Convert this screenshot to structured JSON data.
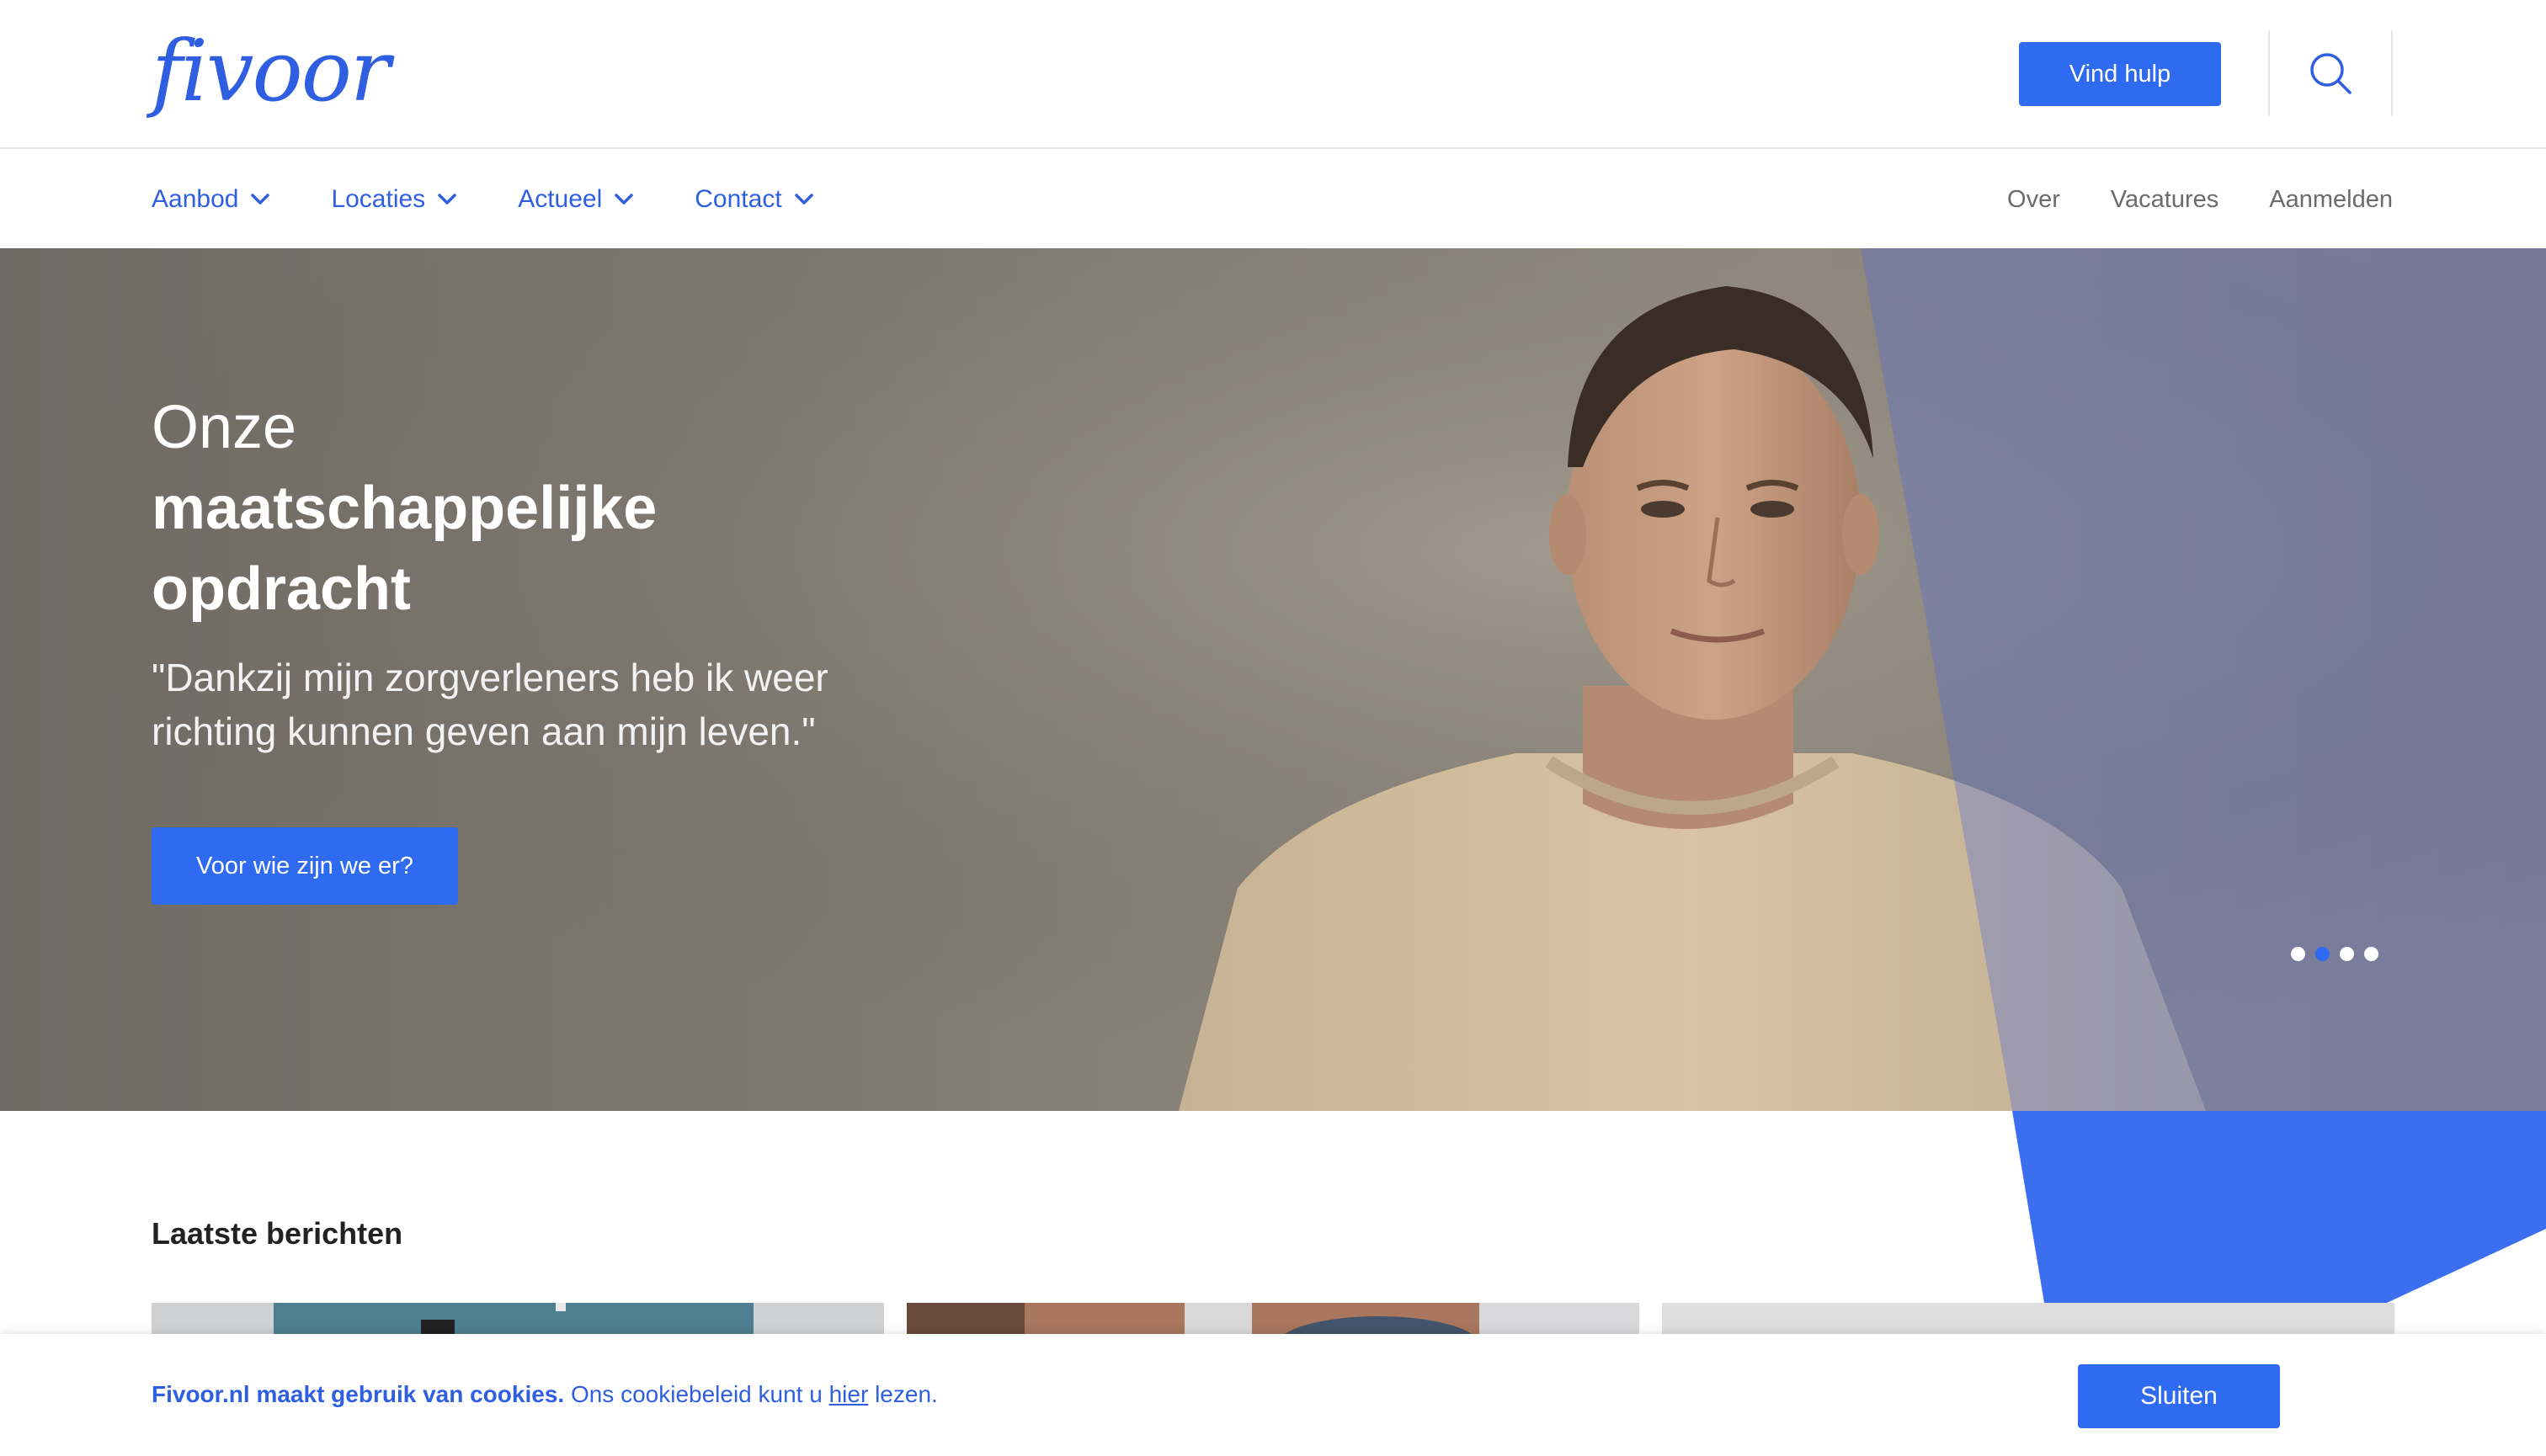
{
  "header": {
    "logo": "fivoor",
    "vind_hulp": "Vind hulp"
  },
  "nav": {
    "main": [
      "Aanbod",
      "Locaties",
      "Actueel",
      "Contact"
    ],
    "secondary": [
      "Over",
      "Vacatures",
      "Aanmelden"
    ]
  },
  "hero": {
    "title_light": "Onze",
    "title_bold_1": "maatschappelijke",
    "title_bold_2": "opdracht",
    "quote": "\"Dankzij mijn zorgverleners heb ik weer richting kunnen geven aan mijn leven.\"",
    "cta": "Voor wie zijn we er?",
    "slide_count": 4,
    "active_slide": 2
  },
  "news": {
    "title": "Laatste berichten"
  },
  "cookie": {
    "bold": "Fivoor.nl maakt gebruik van cookies.",
    "text_before": " Ons cookiebeleid kunt u ",
    "link": "hier",
    "text_after": " lezen.",
    "button": "Sluiten"
  },
  "colors": {
    "brand_blue": "#2f6bf0",
    "text_blue": "#2f5fe0"
  },
  "icons": [
    "search-icon",
    "chevron-down-icon"
  ]
}
